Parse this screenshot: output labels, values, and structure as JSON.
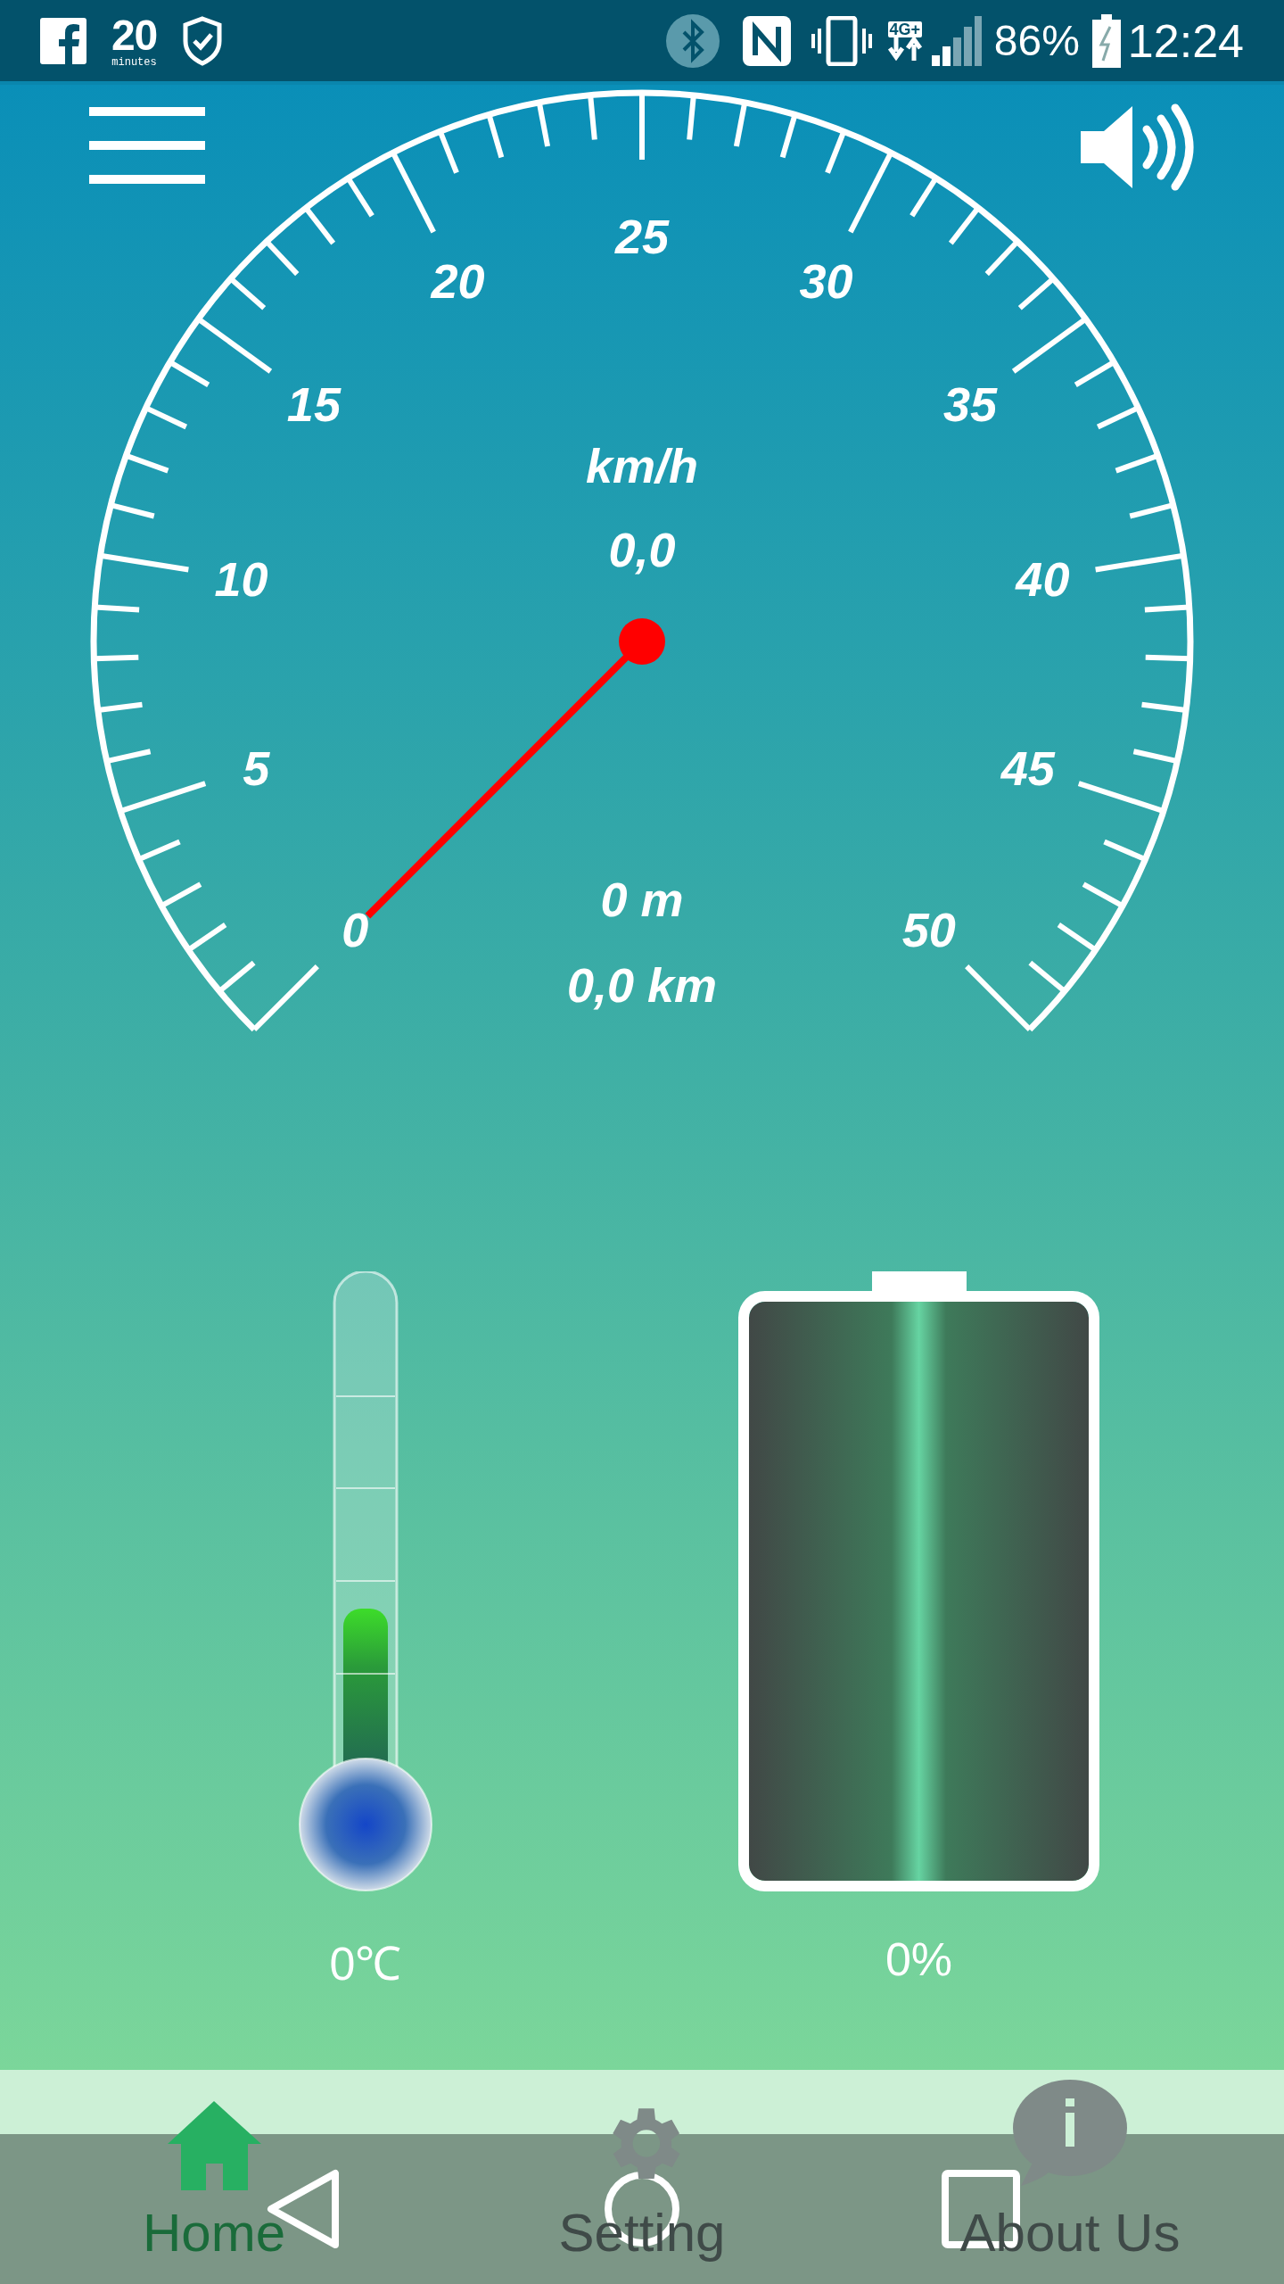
{
  "status_bar": {
    "logo_number": "20",
    "logo_caption": "minutes",
    "network_type": "4G+",
    "battery": "86%",
    "time": "12:24"
  },
  "speedometer": {
    "scale_labels": [
      "0",
      "5",
      "10",
      "15",
      "20",
      "25",
      "30",
      "35",
      "40",
      "45",
      "50"
    ],
    "unit": "km/h",
    "speed": "0,0",
    "distance_m": "0 m",
    "distance_km": "0,0 km"
  },
  "thermometer": {
    "reading": "0℃"
  },
  "battery": {
    "reading": "0%"
  },
  "tabs": [
    {
      "label": "Home",
      "kind": "home",
      "selected": true
    },
    {
      "label": "Setting",
      "kind": "settings",
      "selected": false
    },
    {
      "label": "About Us",
      "kind": "info",
      "selected": false
    }
  ]
}
